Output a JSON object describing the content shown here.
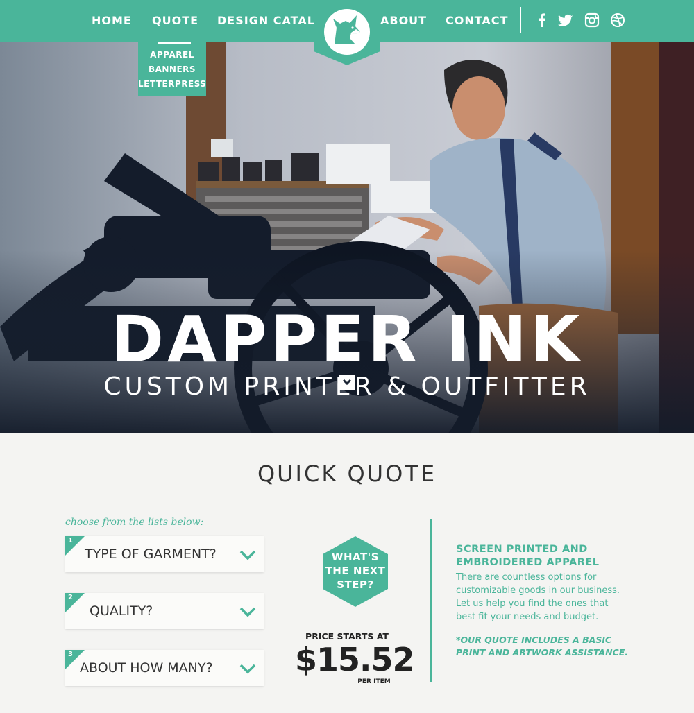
{
  "nav": {
    "items": [
      "HOME",
      "QUOTE",
      "DESIGN CATALOG",
      "ABOUT",
      "CONTACT"
    ],
    "social": [
      "facebook-icon",
      "twitter-icon",
      "instagram-icon",
      "dribbble-icon"
    ],
    "dropdown": [
      "APPAREL",
      "BANNERS",
      "LETTERPRESS"
    ]
  },
  "hero": {
    "title": "DAPPER INK",
    "subtitle": "CUSTOM PRINTER & OUTFITTER"
  },
  "quote": {
    "title": "QUICK QUOTE",
    "instruction": "choose from the lists below:",
    "selects": [
      {
        "number": "1",
        "label": "TYPE OF GARMENT?"
      },
      {
        "number": "2",
        "label": "QUALITY?"
      },
      {
        "number": "3",
        "label": "ABOUT HOW MANY?"
      }
    ],
    "next_step": [
      "WHAT'S",
      "THE NEXT",
      "STEP?"
    ],
    "price_label": "PRICE STARTS AT",
    "price": "$15.52",
    "per_item": "PER ITEM"
  },
  "info": {
    "heading_line1": "SCREEN PRINTED AND",
    "heading_line2": "EMBROIDERED APPAREL",
    "body": [
      "There are countless options for",
      "customizable goods in our business.",
      "Let us help you find the ones that",
      "best fit your needs and budget."
    ],
    "note_line1": "*OUR QUOTE INCLUDES A BASIC",
    "note_line2": "PRINT AND ARTWORK ASSISTANCE."
  },
  "colors": {
    "accent": "#4ab59a",
    "text": "#333333",
    "background": "#f4f4f2"
  }
}
